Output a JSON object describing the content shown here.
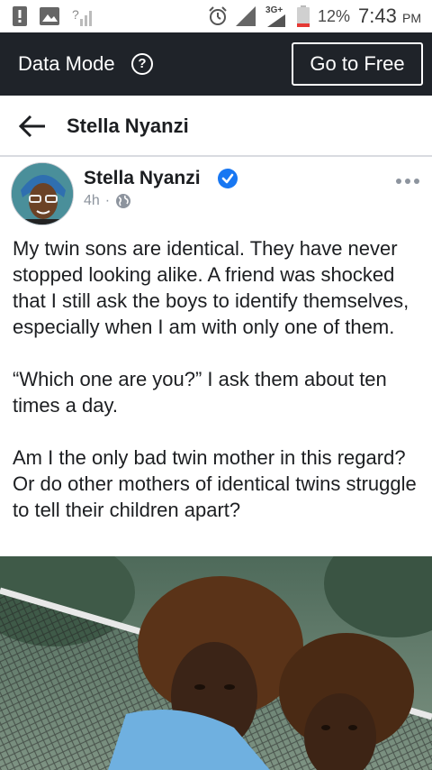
{
  "status_bar": {
    "time": "7:43",
    "ampm": "PM",
    "battery": "12%",
    "network": "3G+"
  },
  "data_mode": {
    "label": "Data Mode",
    "help_symbol": "?",
    "button": "Go to Free"
  },
  "header": {
    "title": "Stella Nyanzi"
  },
  "post": {
    "author": "Stella Nyanzi",
    "time": "4h",
    "separator": "·",
    "paragraphs": [
      "My twin sons are identical. They have never stopped looking alike. A friend was shocked that I still ask the boys to identify themselves, especially when I am with only one of them.",
      "“Which one are you?” I ask them about ten times a day.",
      "Am I the only bad twin mother in this regard? Or do other mothers of identical twins struggle to tell their children apart?"
    ]
  },
  "colors": {
    "data_bar": "#1f2329",
    "verified": "#1877f2",
    "meta_gray": "#8d949e"
  }
}
